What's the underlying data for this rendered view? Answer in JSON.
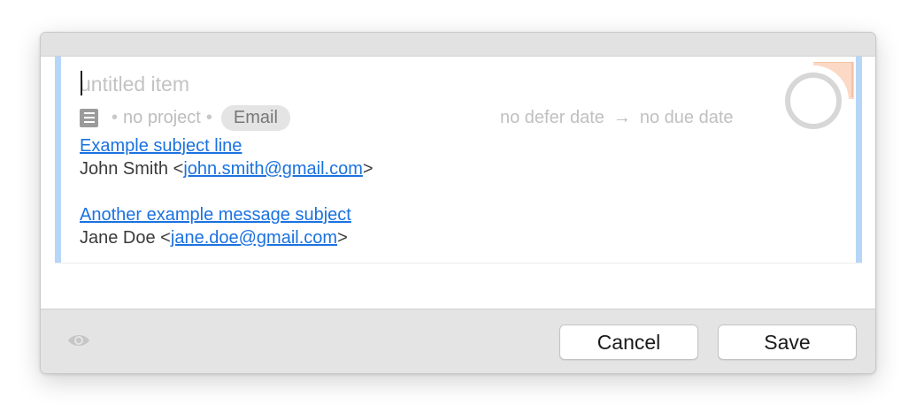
{
  "item": {
    "title_value": "",
    "title_placeholder": "untitled item",
    "project": "no project",
    "separator": "•",
    "tag": "Email",
    "defer_date": "no defer date",
    "arrow": "→",
    "due_date": "no due date"
  },
  "notes": [
    {
      "subject": "Example subject line",
      "sender_name": "John Smith",
      "sender_email": "john.smith@gmail.com"
    },
    {
      "subject": "Another example message subject",
      "sender_name": "Jane Doe",
      "sender_email": "jane.doe@gmail.com"
    }
  ],
  "footer": {
    "cancel_label": "Cancel",
    "save_label": "Save"
  },
  "icons": {
    "note": "note-icon",
    "status": "status-circle-icon",
    "flag": "flag-corner-icon",
    "eye": "eye-icon"
  },
  "colors": {
    "accent_border": "#b6d6f8",
    "link": "#1b72e0",
    "flag": "#fbd9c6"
  }
}
